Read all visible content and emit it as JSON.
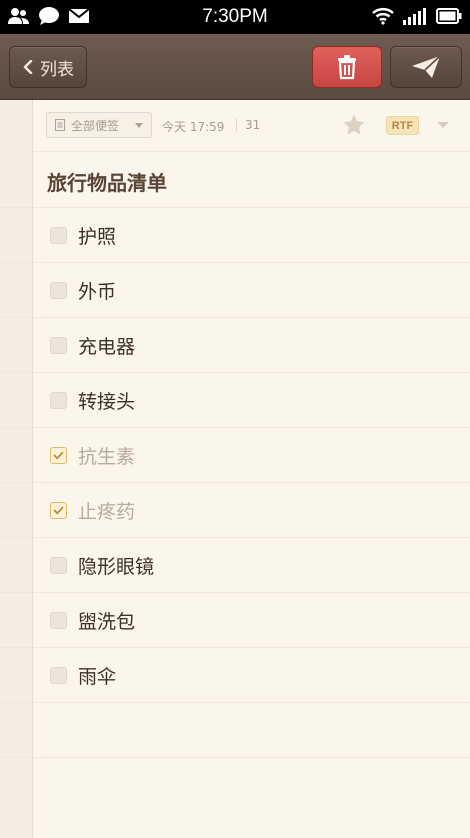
{
  "status_bar": {
    "time": "7:30PM",
    "left_icons": [
      "contacts-icon",
      "chat-icon",
      "mail-icon"
    ],
    "right_icons": [
      "wifi-icon",
      "signal-icon",
      "battery-icon"
    ]
  },
  "toolbar": {
    "back_label": "列表",
    "delete_icon": "trash-icon",
    "send_icon": "paper-plane-icon",
    "colors": {
      "delete": "#d9534f",
      "toolbar": "#5f4e43"
    }
  },
  "meta": {
    "folder": "全部便签",
    "time": "今天 17:59",
    "count": "31",
    "format_badge": "RTF"
  },
  "note": {
    "title": "旅行物品清单",
    "items": [
      {
        "label": "护照",
        "checked": false
      },
      {
        "label": "外币",
        "checked": false
      },
      {
        "label": "充电器",
        "checked": false
      },
      {
        "label": "转接头",
        "checked": false
      },
      {
        "label": "抗生素",
        "checked": true
      },
      {
        "label": "止疼药",
        "checked": true
      },
      {
        "label": "隐形眼镜",
        "checked": false
      },
      {
        "label": "盥洗包",
        "checked": false
      },
      {
        "label": "雨伞",
        "checked": false
      }
    ]
  }
}
